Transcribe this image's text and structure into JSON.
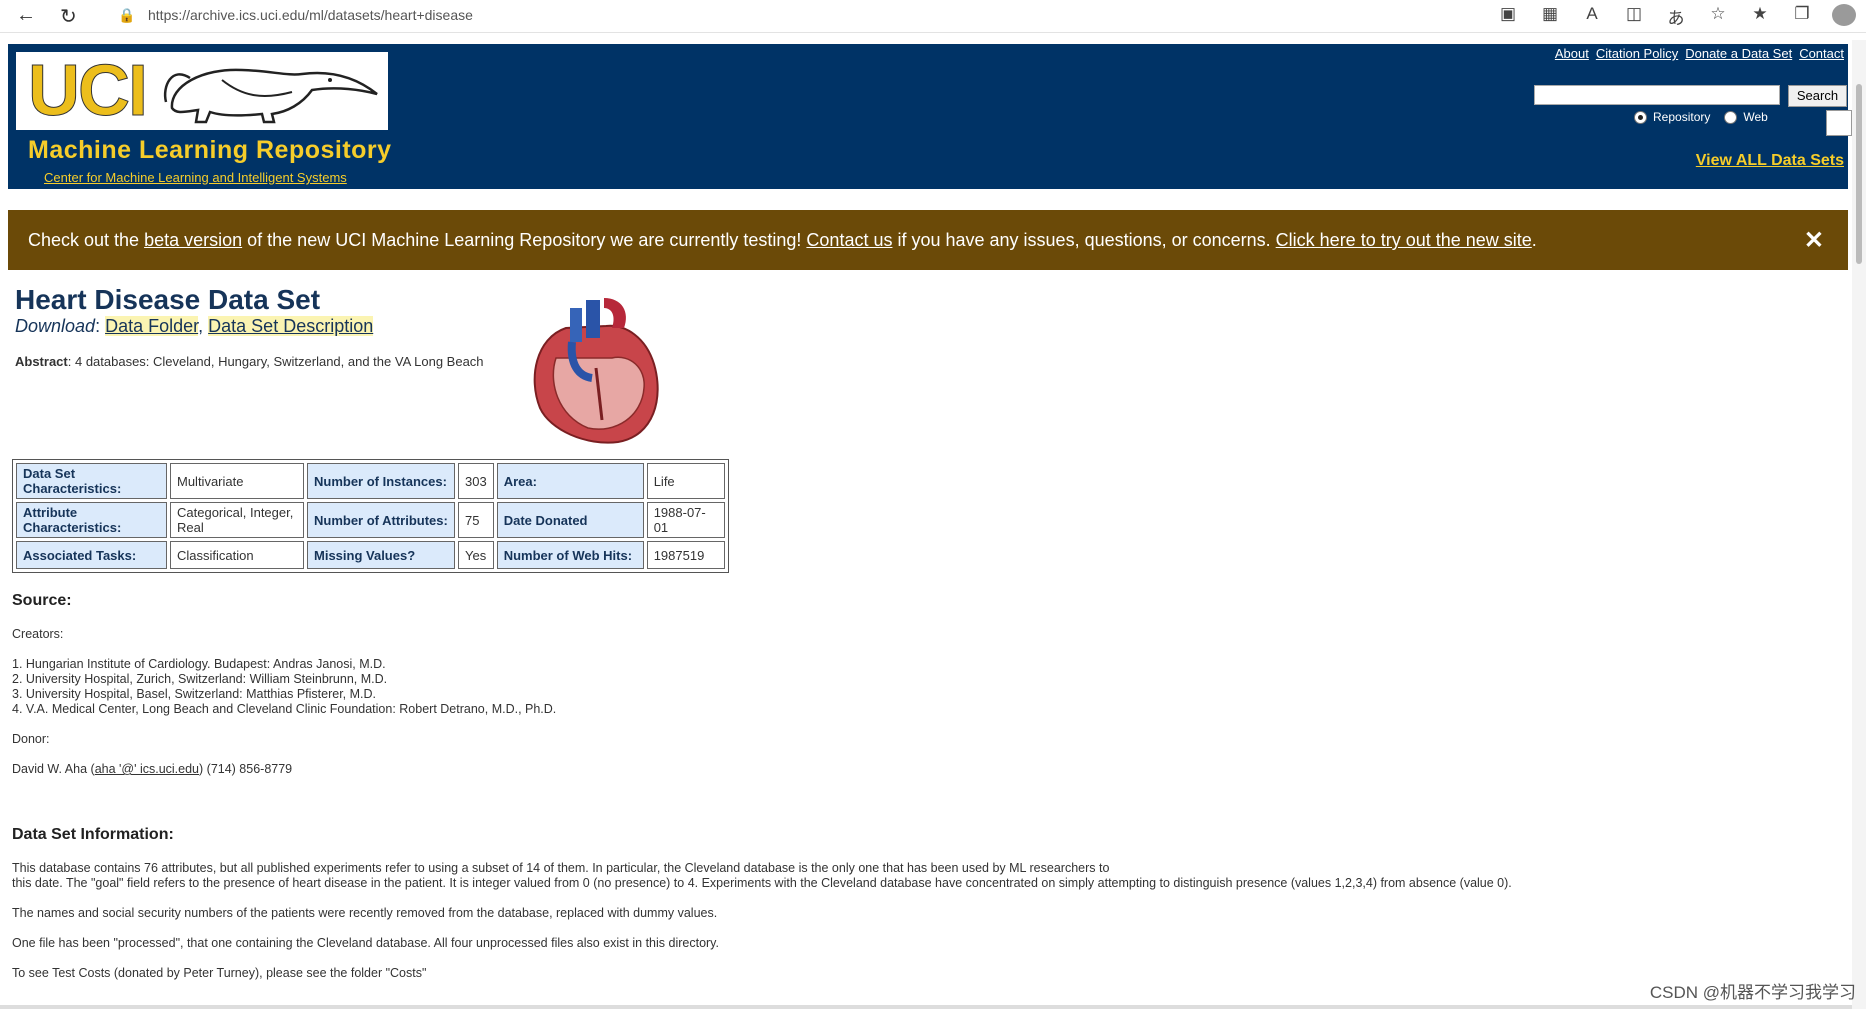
{
  "browser": {
    "url": "https://archive.ics.uci.edu/ml/datasets/heart+disease"
  },
  "header": {
    "logo_text": "UCI",
    "title": "Machine Learning Repository",
    "subtitle": "Center for Machine Learning and Intelligent Systems",
    "links": [
      "About",
      "Citation Policy",
      "Donate a Data Set",
      "Contact"
    ],
    "search_button": "Search",
    "radio_repository": "Repository",
    "radio_web": "Web",
    "view_all": "View ALL Data Sets"
  },
  "banner": {
    "part1": "Check out the ",
    "link1": "beta version",
    "part2": " of the new UCI Machine Learning Repository we are currently testing! ",
    "link2": "Contact us",
    "part3": " if you have any issues, questions, or concerns. ",
    "link3": "Click here to try out the new site",
    "part4": ".",
    "close": "✕"
  },
  "dataset": {
    "title": "Heart Disease Data Set",
    "download_label": "Download",
    "download_sep": ": ",
    "link_folder": "Data Folder",
    "link_desc": "Data Set Description",
    "abstract_label": "Abstract",
    "abstract_text": ": 4 databases: Cleveland, Hungary, Switzerland, and the VA Long Beach"
  },
  "table": {
    "rows": [
      [
        "Data Set Characteristics:",
        "Multivariate",
        "Number of Instances:",
        "303",
        "Area:",
        "Life"
      ],
      [
        "Attribute Characteristics:",
        "Categorical, Integer, Real",
        "Number of Attributes:",
        "75",
        "Date Donated",
        "1988-07-01"
      ],
      [
        "Associated Tasks:",
        "Classification",
        "Missing Values?",
        "Yes",
        "Number of Web Hits:",
        "1987519"
      ]
    ]
  },
  "source": {
    "heading": "Source:",
    "creators_label": "Creators:",
    "creators": [
      "1. Hungarian Institute of Cardiology. Budapest: Andras Janosi, M.D.",
      "2. University Hospital, Zurich, Switzerland: William Steinbrunn, M.D.",
      "3. University Hospital, Basel, Switzerland: Matthias Pfisterer, M.D.",
      "4. V.A. Medical Center, Long Beach and Cleveland Clinic Foundation: Robert Detrano, M.D., Ph.D."
    ],
    "donor_label": "Donor:",
    "donor_name": "David W. Aha (",
    "donor_email": "aha '@' ics.uci.edu",
    "donor_phone": ") (714) 856-8779"
  },
  "info": {
    "heading": "Data Set Information:",
    "p1a": "This database contains 76 attributes, but all published experiments refer to using a subset of 14 of them. In particular, the Cleveland database is the only one that has been used by ML researchers to",
    "p1b": "this date. The \"goal\" field refers to the presence of heart disease in the patient. It is integer valued from 0 (no presence) to 4. Experiments with the Cleveland database have concentrated on simply attempting to distinguish presence (values 1,2,3,4) from absence (value 0).",
    "p2": "The names and social security numbers of the patients were recently removed from the database, replaced with dummy values.",
    "p3": "One file has been \"processed\", that one containing the Cleveland database. All four unprocessed files also exist in this directory.",
    "p4": "To see Test Costs (donated by Peter Turney), please see the folder \"Costs\""
  },
  "watermark": "CSDN @机器不学习我学习"
}
